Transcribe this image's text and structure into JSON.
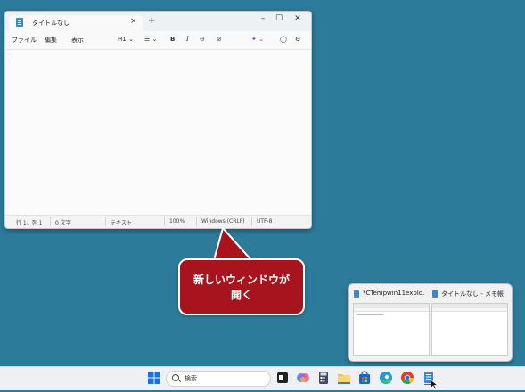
{
  "notepad": {
    "tab_title": "タイトルなし",
    "tab_close": "×",
    "new_tab": "+",
    "minimize": "–",
    "maximize": "☐",
    "close": "✕",
    "menus": [
      "ファイル",
      "編集",
      "表示"
    ],
    "toolbar": {
      "heading": "H1 ⌄",
      "list": "☰ ⌄",
      "bold": "B",
      "italic": "I",
      "link": "⊝",
      "clear": "⊘",
      "copilot": "✦ ⌄",
      "account": "◯",
      "settings": "⚙"
    },
    "status": {
      "position": "行 1、列 1",
      "chars": "0 文字",
      "format": "テキスト",
      "zoom": "100%",
      "line_ending": "Windows (CRLF)",
      "encoding": "UTF-8"
    }
  },
  "callout": {
    "line1": "新しいウィンドウが",
    "line2": "開く",
    "color": "#a8141e"
  },
  "preview": {
    "window1_title": "*CTempwin11explo…",
    "window2_title": "タイトルなし - メモ帳"
  },
  "taskbar": {
    "search_label": "検索",
    "icons": [
      "windows-start-icon",
      "search-icon",
      "terminal-icon",
      "copilot-icon",
      "calculator-icon",
      "file-explorer-icon",
      "store-icon",
      "edge-icon",
      "chrome-icon",
      "notepad-icon"
    ]
  },
  "colors": {
    "desktop": "#2c7b9a",
    "accent": "#3c86d4"
  }
}
